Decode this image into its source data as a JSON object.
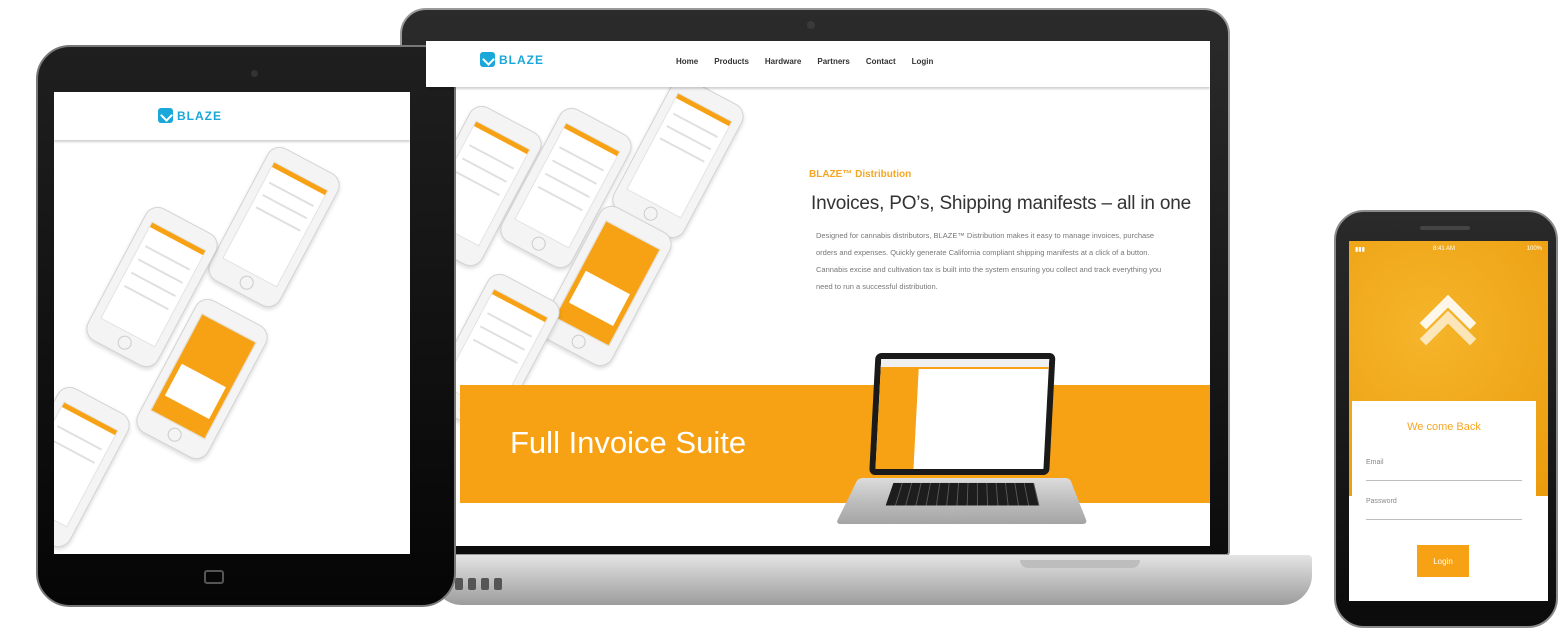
{
  "laptop": {
    "site": {
      "logo_text": "BLAZE",
      "nav": [
        "Home",
        "Products",
        "Hardware",
        "Partners",
        "Contact",
        "Login"
      ],
      "hero": {
        "kicker": "BLAZE™ Distribution",
        "title": "Invoices, PO’s, Shipping manifests – all in one",
        "description": "Designed for cannabis distributors, BLAZE™ Distribution makes it easy to manage invoices, purchase orders and expenses. Quickly generate California compliant shipping manifests at a click of a button. Cannabis excise and cultivation tax is built into the system ensuring you collect and track everything you need to run a successful distribution."
      },
      "band_title": "Full Invoice Suite"
    }
  },
  "tablet": {
    "site": {
      "logo_text": "BLAZE"
    }
  },
  "phone": {
    "status": {
      "time": "8:41 AM",
      "battery": "100%"
    },
    "login": {
      "welcome": "We come Back",
      "email_label": "Email",
      "password_label": "Password",
      "button": "Login"
    }
  },
  "colors": {
    "accent": "#f7a214",
    "brand": "#1aa7d9"
  }
}
